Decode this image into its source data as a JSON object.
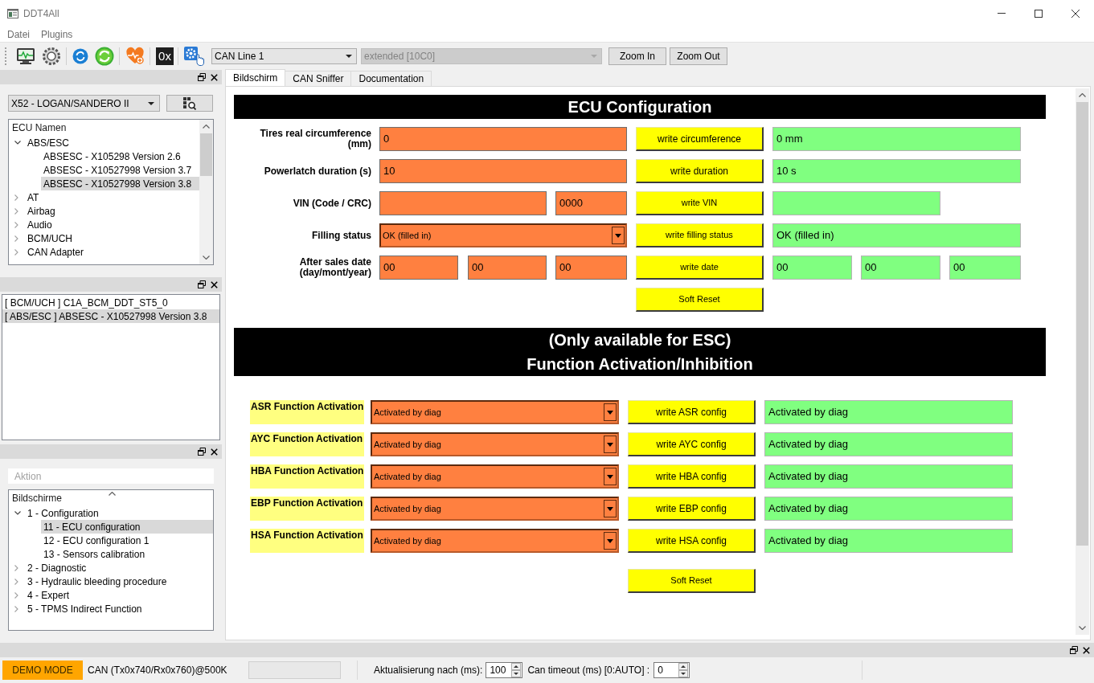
{
  "window": {
    "title": "DDT4All"
  },
  "menu": [
    "Datei",
    "Plugins"
  ],
  "toolbar": {
    "hex_button": "0x",
    "can_line": "CAN Line 1",
    "can_mode": {
      "value": "extended [10C0]",
      "disabled": true
    },
    "buttons": [
      "Zoom In",
      "Zoom Out"
    ]
  },
  "vehicle_panel": {
    "vehicle": "X52 - LOGAN/SANDERO II",
    "tree": {
      "header": "ECU Namen",
      "items": [
        {
          "label": "ABS/ESC",
          "expanded": true,
          "selected": false,
          "children": [
            {
              "label": "ABSESC - X105298 Version 2.6",
              "selected": false
            },
            {
              "label": "ABSESC - X10527998 Version 3.7",
              "selected": false
            },
            {
              "label": "ABSESC - X10527998 Version 3.8",
              "selected": true
            }
          ]
        },
        {
          "label": "AT",
          "expanded": false,
          "selected": false
        },
        {
          "label": "Airbag",
          "expanded": false,
          "selected": false
        },
        {
          "label": "Audio",
          "expanded": false,
          "selected": false
        },
        {
          "label": "BCM/UCH",
          "expanded": false,
          "selected": false
        },
        {
          "label": "CAN Adapter",
          "expanded": false,
          "selected": false
        }
      ]
    }
  },
  "ecu_list": [
    {
      "label": "[ BCM/UCH ] C1A_BCM_DDT_ST5_0",
      "selected": false
    },
    {
      "label": "[ ABS/ESC ] ABSESC - X10527998 Version 3.8",
      "selected": true
    }
  ],
  "screens_panel": {
    "filter": {
      "placeholder": "Aktion"
    },
    "tree": {
      "header": "Bildschirme",
      "items": [
        {
          "label": "1 - Configuration",
          "expanded": true,
          "selected": false,
          "children": [
            {
              "label": "11 - ECU configuration",
              "selected": true
            },
            {
              "label": "12 - ECU configuration 1",
              "selected": false
            },
            {
              "label": "13 - Sensors calibration",
              "selected": false
            }
          ]
        },
        {
          "label": "2 - Diagnostic",
          "expanded": false,
          "selected": false
        },
        {
          "label": "3 - Hydraulic bleeding procedure",
          "expanded": false,
          "selected": false
        },
        {
          "label": "4 - Expert",
          "expanded": false,
          "selected": false
        },
        {
          "label": "5 - TPMS Indirect Function",
          "expanded": false,
          "selected": false
        }
      ]
    }
  },
  "tabs": [
    {
      "label": "Bildschirm",
      "selected": true
    },
    {
      "label": "CAN Sniffer",
      "selected": false
    },
    {
      "label": "Documentation",
      "selected": false
    }
  ],
  "form": {
    "sections": [
      {
        "title": [
          "ECU Configuration"
        ],
        "rows": [
          {
            "kind": "text",
            "label": "Tires real circumference\n(mm)",
            "inputs": [
              "0"
            ],
            "button": "write circumference",
            "outputs": [
              "0 mm"
            ]
          },
          {
            "kind": "text",
            "label": "Powerlatch duration (s)",
            "inputs": [
              "10"
            ],
            "button": "write duration",
            "outputs": [
              "10 s"
            ]
          },
          {
            "kind": "vin",
            "label": "VIN (Code / CRC)",
            "crc": "0000",
            "button": "write VIN"
          },
          {
            "kind": "combo",
            "label": "Filling status",
            "value": "OK (filled in)",
            "button": "write filling status",
            "outputs": [
              "OK (filled in)"
            ]
          },
          {
            "kind": "date",
            "label": "After sales date\n(day/mont/year)",
            "inputs": [
              "00",
              "00",
              "00"
            ],
            "button": "write date",
            "outputs": [
              "00",
              "00",
              "00"
            ]
          }
        ],
        "reset_button": "Soft Reset"
      },
      {
        "title": [
          "(Only available for ESC)",
          "Function Activation/Inhibition"
        ],
        "rows": [
          {
            "kind": "function",
            "label": "ASR Function Activation",
            "value": "Activated by diag",
            "button": "write ASR config",
            "outputs": [
              "Activated by diag"
            ]
          },
          {
            "kind": "function",
            "label": "AYC Function Activation",
            "value": "Activated by diag",
            "button": "write AYC config",
            "outputs": [
              "Activated by diag"
            ]
          },
          {
            "kind": "function",
            "label": "HBA Function Activation",
            "value": "Activated by diag",
            "button": "write HBA config",
            "outputs": [
              "Activated by diag"
            ]
          },
          {
            "kind": "function",
            "label": "EBP Function Activation",
            "value": "Activated by diag",
            "button": "write EBP config",
            "outputs": [
              "Activated by diag"
            ]
          },
          {
            "kind": "function",
            "label": "HSA Function Activation",
            "value": "Activated by diag",
            "button": "write HSA config",
            "outputs": [
              "Activated by diag"
            ]
          }
        ],
        "reset_button": "Soft Reset"
      }
    ]
  },
  "status_bar": {
    "mode": "DEMO MODE",
    "connection": "CAN (Tx0x740/Rx0x760)@500K",
    "refresh": {
      "label": "Aktualisierung nach (ms):",
      "value": "100"
    },
    "timeout": {
      "label": "Can timeout (ms) [0:AUTO] :",
      "value": "0"
    }
  }
}
